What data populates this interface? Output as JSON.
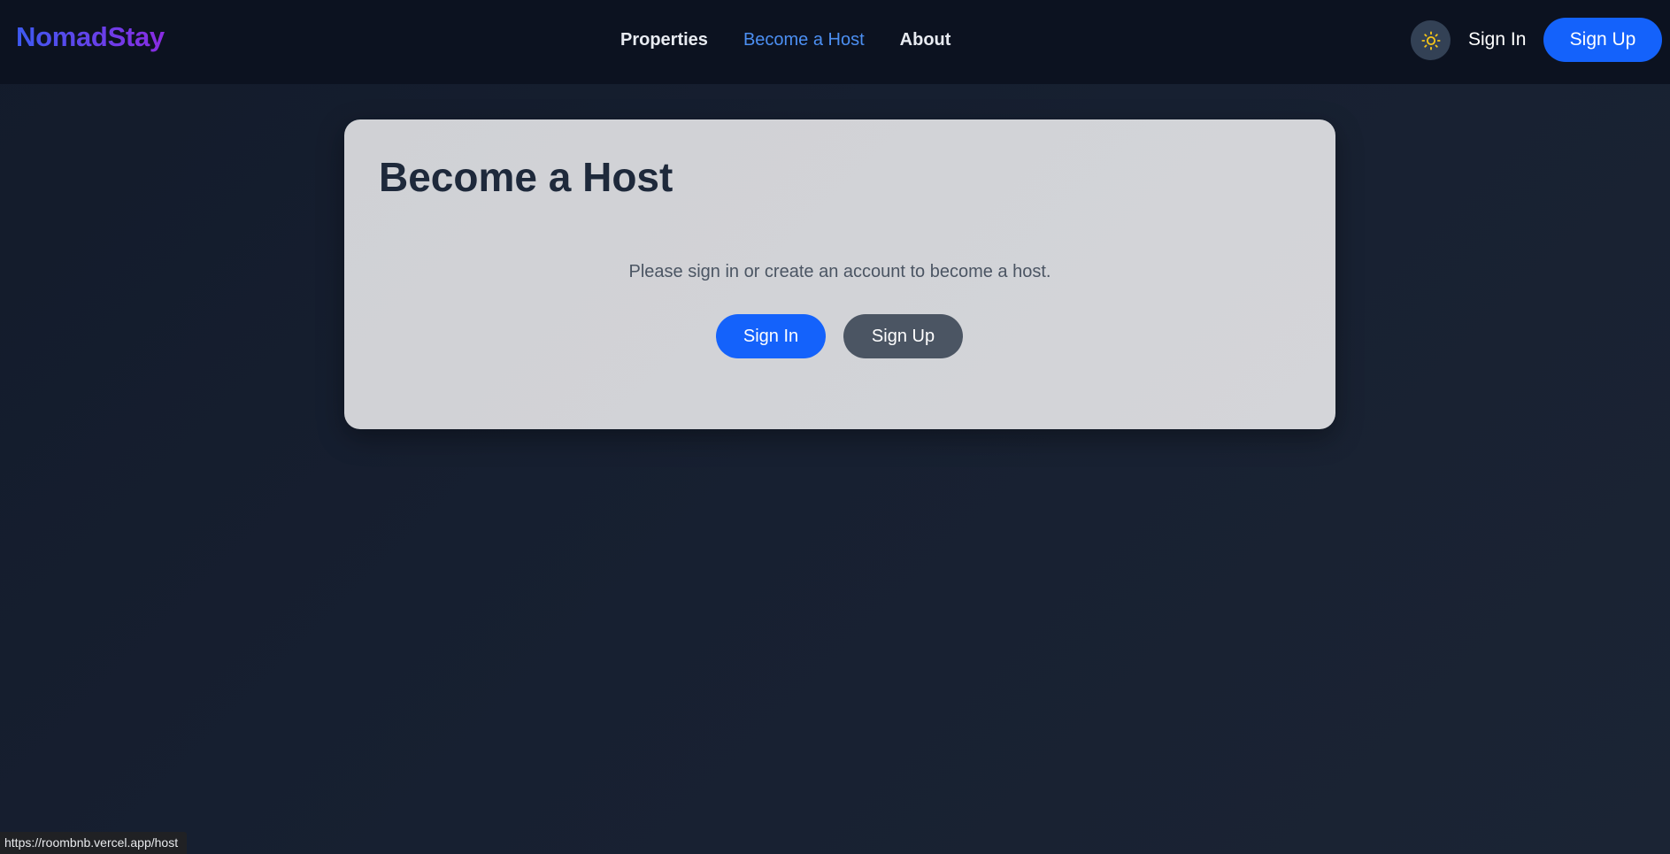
{
  "colors": {
    "brand_gradient_start": "#3d5af1",
    "brand_gradient_end": "#8a2be2",
    "nav_active": "#4c8ff2",
    "primary_button": "#1462fb",
    "secondary_button": "#4b5563",
    "sun_icon": "#f5c518"
  },
  "navbar": {
    "logo": "NomadStay",
    "links": [
      {
        "label": "Properties"
      },
      {
        "label": "Become a Host",
        "active": true
      },
      {
        "label": "About"
      }
    ],
    "theme_toggle_icon": "sun-icon",
    "sign_in_label": "Sign In",
    "sign_up_label": "Sign Up"
  },
  "main": {
    "title": "Become a Host",
    "message": "Please sign in or create an account to become a host.",
    "sign_in_label": "Sign In",
    "sign_up_label": "Sign Up"
  },
  "status_bar": {
    "url": "https://roombnb.vercel.app/host"
  }
}
